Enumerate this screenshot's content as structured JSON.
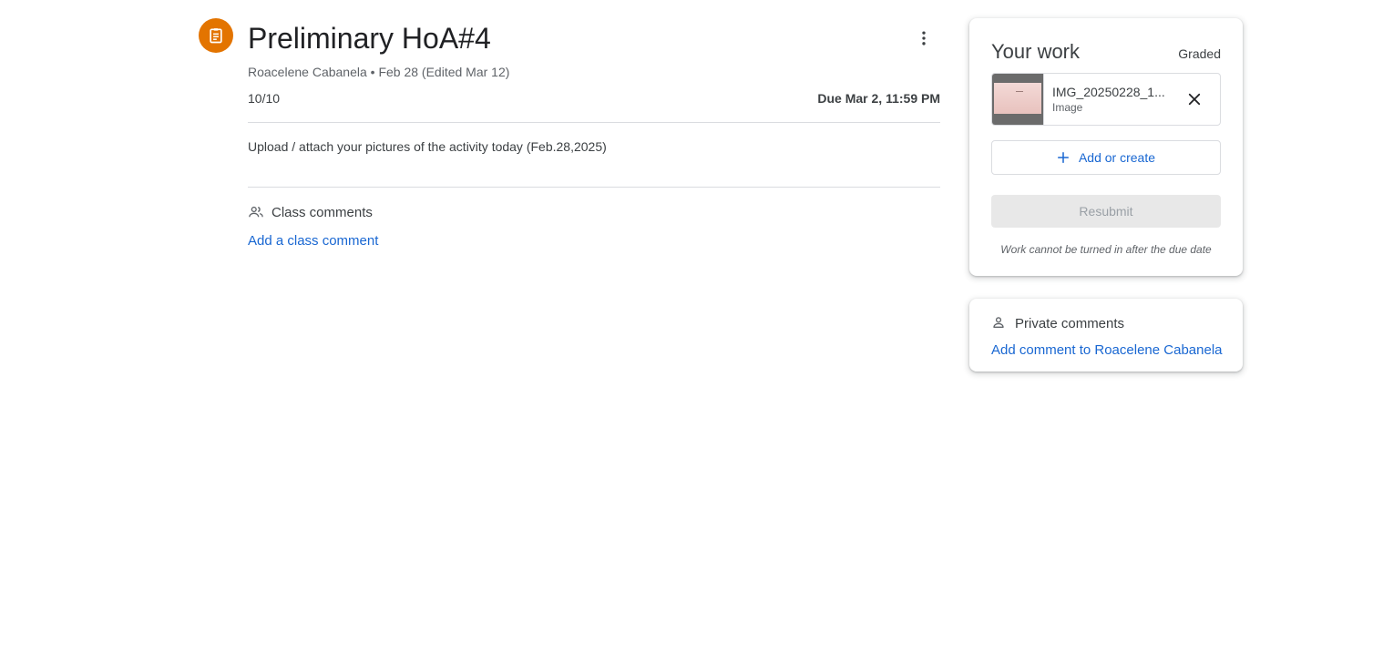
{
  "assignment": {
    "title": "Preliminary HoA#4",
    "meta": "Roacelene Cabanela • Feb 28 (Edited Mar 12)",
    "score": "10/10",
    "due": "Due Mar 2, 11:59 PM",
    "instructions": "Upload / attach your pictures of the activity today (Feb.28,2025)",
    "icon": "assignment-icon",
    "accent_color": "#e37400"
  },
  "class_comments": {
    "label": "Class comments",
    "add_link": "Add a class comment",
    "icon": "people-icon"
  },
  "your_work": {
    "title": "Your work",
    "status": "Graded",
    "attachment": {
      "name": "IMG_20250228_1...",
      "type": "Image"
    },
    "add_or_create": "Add or create",
    "resubmit": "Resubmit",
    "note": "Work cannot be turned in after the due date"
  },
  "private_comments": {
    "label": "Private comments",
    "add_link": "Add comment to Roacelene Cabanela",
    "icon": "person-icon"
  },
  "colors": {
    "link": "#1967d2",
    "text": "#3c4043",
    "muted": "#5f6368"
  }
}
